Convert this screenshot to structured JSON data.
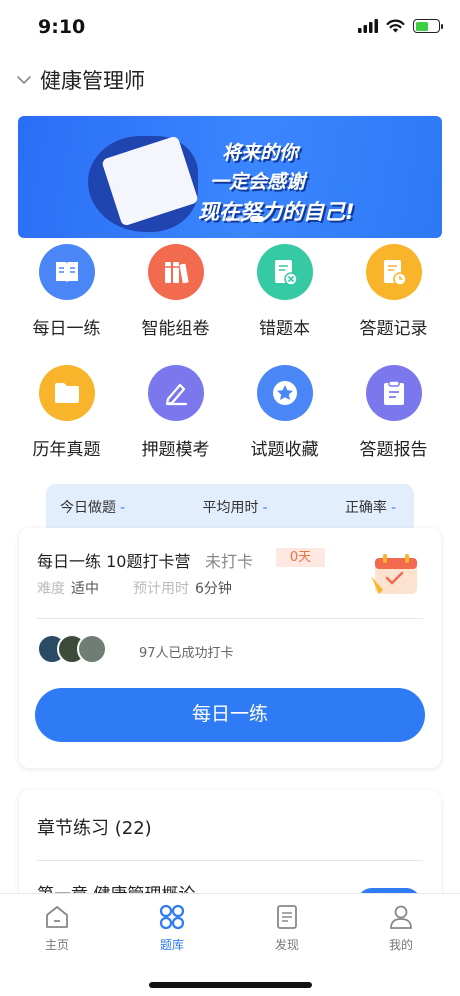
{
  "status_bar": {
    "time": "9:10"
  },
  "header": {
    "title": "健康管理师"
  },
  "banner": {
    "line1": "将来的你",
    "line2": "一定会感谢",
    "line3": "现在努力的自己!"
  },
  "menu": [
    {
      "label": "每日一练",
      "icon": "book-icon",
      "color": "#4a86f5"
    },
    {
      "label": "智能组卷",
      "icon": "books-icon",
      "color": "#f26b4f"
    },
    {
      "label": "错题本",
      "icon": "wrong-note-icon",
      "color": "#35c9a4"
    },
    {
      "label": "答题记录",
      "icon": "record-clock-icon",
      "color": "#f8b52c"
    },
    {
      "label": "历年真题",
      "icon": "folder-icon",
      "color": "#f8b52c"
    },
    {
      "label": "押题模考",
      "icon": "pencil-icon",
      "color": "#7b78ee"
    },
    {
      "label": "试题收藏",
      "icon": "star-icon",
      "color": "#4a86f5"
    },
    {
      "label": "答题报告",
      "icon": "clipboard-icon",
      "color": "#7b78ee"
    }
  ],
  "stats": {
    "today_label": "今日做题",
    "today_value": "-",
    "avg_label": "平均用时",
    "avg_value": "-",
    "accuracy_label": "正确率",
    "accuracy_value": "-"
  },
  "daily": {
    "title": "每日一练 10题打卡营",
    "status": "未打卡",
    "days": "0天",
    "difficulty_label": "难度",
    "difficulty_value": "适中",
    "time_label": "预计用时",
    "time_value": "6分钟",
    "checked_in": "97人已成功打卡",
    "button": "每日一练"
  },
  "chapter": {
    "title": "章节练习 (22)",
    "item": "第一章 健康管理概论"
  },
  "tabs": [
    {
      "label": "主页",
      "icon": "home-icon",
      "active": false
    },
    {
      "label": "题库",
      "icon": "grid-icon",
      "active": true
    },
    {
      "label": "发现",
      "icon": "document-icon",
      "active": false
    },
    {
      "label": "我的",
      "icon": "user-icon",
      "active": false
    }
  ],
  "colors": {
    "accent": "#2f7bf6",
    "badge_bg": "#fde9e2",
    "badge_text": "#f0703f"
  }
}
